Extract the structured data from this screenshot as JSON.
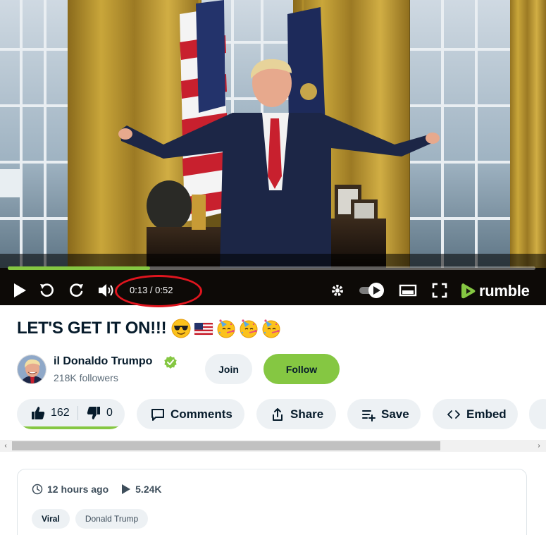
{
  "player": {
    "current_time": "0:13",
    "duration": "0:52",
    "time_display": "0:13 / 0:52",
    "progress_fraction": 0.27,
    "brand": "rumble",
    "controls": [
      "play-icon",
      "replay-icon",
      "forward-icon",
      "volume-icon",
      "settings-icon",
      "autoplay-toggle",
      "theater-icon",
      "fullscreen-icon"
    ]
  },
  "video": {
    "title": "LET'S GET IT ON!!!",
    "title_emojis": [
      "smiling-face-with-sunglasses",
      "us-flag",
      "partying-face",
      "partying-face",
      "partying-face"
    ]
  },
  "channel": {
    "name": "il Donaldo Trumpo",
    "followers": "218K followers",
    "verified": true,
    "join_label": "Join",
    "follow_label": "Follow"
  },
  "actions": {
    "likes": "162",
    "dislikes": "0",
    "like_ratio": 1.0,
    "comments_label": "Comments",
    "share_label": "Share",
    "save_label": "Save",
    "embed_label": "Embed"
  },
  "scrollbar": {
    "left_arrow": "‹",
    "right_arrow": "›"
  },
  "info": {
    "posted": "12 hours ago",
    "views": "5.24K",
    "tags": [
      "Viral",
      "Donald Trump"
    ]
  },
  "colors": {
    "accent": "#85c742",
    "chip_bg": "#edf1f4",
    "text": "#061b2b",
    "highlight_ring": "#e0151e"
  }
}
